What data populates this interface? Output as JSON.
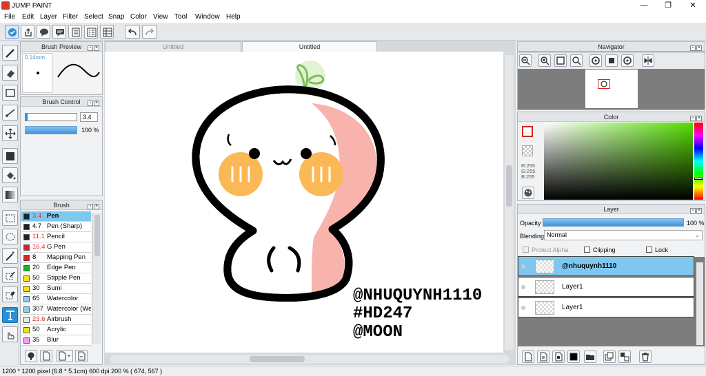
{
  "app": {
    "title": "JUMP PAINT"
  },
  "window": {
    "minimize": "—",
    "restore": "❐",
    "close": "✕"
  },
  "menu": [
    "File",
    "Edit",
    "Layer",
    "Filter",
    "Select",
    "Snap",
    "Color",
    "View",
    "Tool",
    "Window",
    "Help"
  ],
  "panels": {
    "brush_preview": {
      "title": "Brush Preview",
      "size": "0.14mm"
    },
    "brush_control": {
      "title": "Brush Control",
      "size_value": "3.4",
      "opacity_value": "100 %"
    },
    "brush": {
      "title": "Brush",
      "items": [
        {
          "size": "3.4",
          "name": "Pen",
          "color": "#222222",
          "size_color": "#e03030"
        },
        {
          "size": "4.7",
          "name": "Pen (Sharp)",
          "color": "#222222",
          "size_color": "#000000"
        },
        {
          "size": "11.1",
          "name": "Pencil",
          "color": "#222222",
          "size_color": "#e03030"
        },
        {
          "size": "16.4",
          "name": "G Pen",
          "color": "#e02020",
          "size_color": "#e03030"
        },
        {
          "size": "8",
          "name": "Mapping Pen",
          "color": "#e02020",
          "size_color": "#000000"
        },
        {
          "size": "20",
          "name": "Edge Pen",
          "color": "#20b020",
          "size_color": "#000000"
        },
        {
          "size": "50",
          "name": "Stipple Pen",
          "color": "#f0e020",
          "size_color": "#000000"
        },
        {
          "size": "30",
          "name": "Sumi",
          "color": "#f0e020",
          "size_color": "#000000"
        },
        {
          "size": "65",
          "name": "Watercolor",
          "color": "#80d0f0",
          "size_color": "#000000"
        },
        {
          "size": "307",
          "name": "Watercolor (We",
          "color": "#80d0f0",
          "size_color": "#000000"
        },
        {
          "size": "23.6",
          "name": "Airbrush",
          "color": "#e8e8e8",
          "size_color": "#e03030"
        },
        {
          "size": "50",
          "name": "Acrylic",
          "color": "#f0e020",
          "size_color": "#000000"
        },
        {
          "size": "35",
          "name": "Blur",
          "color": "#f0a0f0",
          "size_color": "#000000"
        }
      ]
    },
    "navigator": {
      "title": "Navigator"
    },
    "color": {
      "title": "Color",
      "r": "R:255",
      "g": "G:255",
      "b": "B:255"
    },
    "layer": {
      "title": "Layer",
      "opacity_label": "Opacity",
      "opacity_value": "100 %",
      "opacity_level": 1.0,
      "blending_label": "Blending",
      "blending_value": "Normal",
      "protect_alpha": "Protect Alpha",
      "clipping": "Clipping",
      "lock": "Lock",
      "layers": [
        {
          "name": "@nhuquynh1110",
          "selected": true
        },
        {
          "name": "Layer1",
          "selected": false
        },
        {
          "name": "Layer1",
          "selected": false
        }
      ]
    }
  },
  "tabs": [
    {
      "label": "Untitled",
      "active": false
    },
    {
      "label": "Untitled",
      "active": true
    }
  ],
  "canvas_text": [
    "@NHUQUYNH1110",
    "#HD247",
    "@MOON"
  ],
  "status": "1200 * 1200 pixel   (6.8 * 5.1cm)   600 dpi   200 %   ( 674, 567 )",
  "colors": {
    "accent": "#2a8fd8",
    "selected_row": "#7ec8f0",
    "skin_pink": "#f8b4ac",
    "blush": "#fbb857",
    "sprout": "#7fbf5a"
  }
}
